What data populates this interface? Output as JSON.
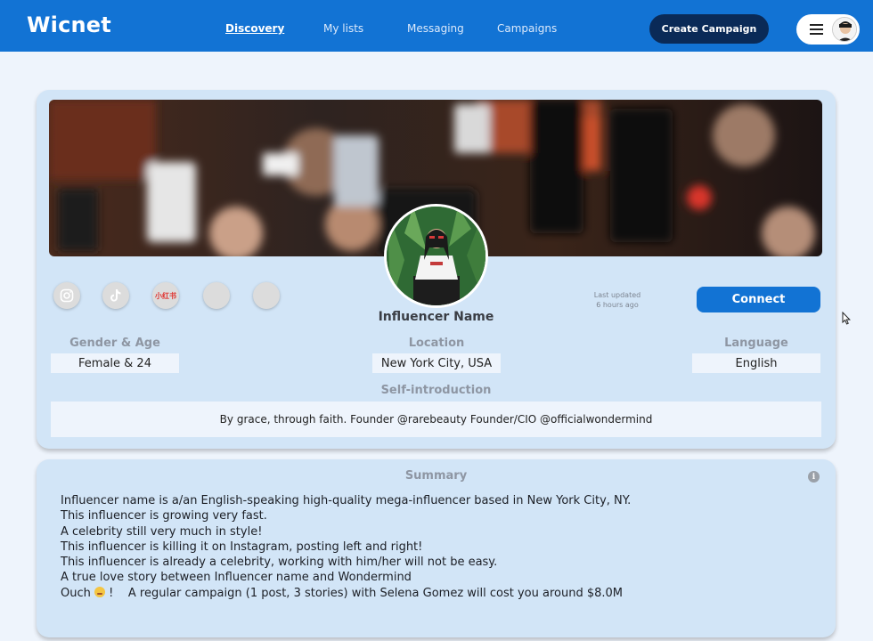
{
  "app": {
    "logo": "Wicnet"
  },
  "nav": {
    "items": [
      {
        "label": "Discovery",
        "active": true
      },
      {
        "label": "My lists",
        "active": false
      },
      {
        "label": "Messaging",
        "active": false
      },
      {
        "label": "Campaigns",
        "active": false
      }
    ],
    "create_label": "Create Campaign"
  },
  "profile": {
    "name": "Influencer Name",
    "last_updated_line1": "Last updated",
    "last_updated_line2": "6 hours ago",
    "connect_label": "Connect",
    "socials": [
      {
        "icon": "instagram-icon"
      },
      {
        "icon": "tiktok-icon"
      },
      {
        "icon": "xiaohongshu-icon",
        "text": "小红书"
      },
      {
        "icon": "empty-social-icon"
      },
      {
        "icon": "empty-social-icon"
      }
    ],
    "gender_age": {
      "label": "Gender & Age",
      "value": "Female & 24"
    },
    "location": {
      "label": "Location",
      "value": "New York City, USA"
    },
    "language": {
      "label": "Language",
      "value": "English"
    },
    "self_intro": {
      "label": "Self-introduction",
      "value": "By grace, through faith. Founder @rarebeauty Founder/CIO @officialwondermind"
    }
  },
  "summary": {
    "title": "Summary",
    "lines": [
      "Influencer name is a/an English-speaking high-quality mega-influencer based in New York City, NY.",
      "This influencer is growing very fast.",
      "A celebrity still very much in style!",
      "This influencer is killing it on Instagram, posting left and right!",
      "This influencer is already a celebrity, working with him/her will not be easy.",
      "A true love story between Influencer name and Wondermind"
    ],
    "last_line_prefix": "Ouch",
    "last_line_bang": "!",
    "last_line_rest": "A regular campaign (1 post, 3 stories) with Selena Gomez will cost you around $8.0M"
  },
  "colors": {
    "primary": "#1273d4",
    "dark_button": "#0a2a57",
    "card": "#d2e5f7",
    "background": "#eef4fc"
  }
}
